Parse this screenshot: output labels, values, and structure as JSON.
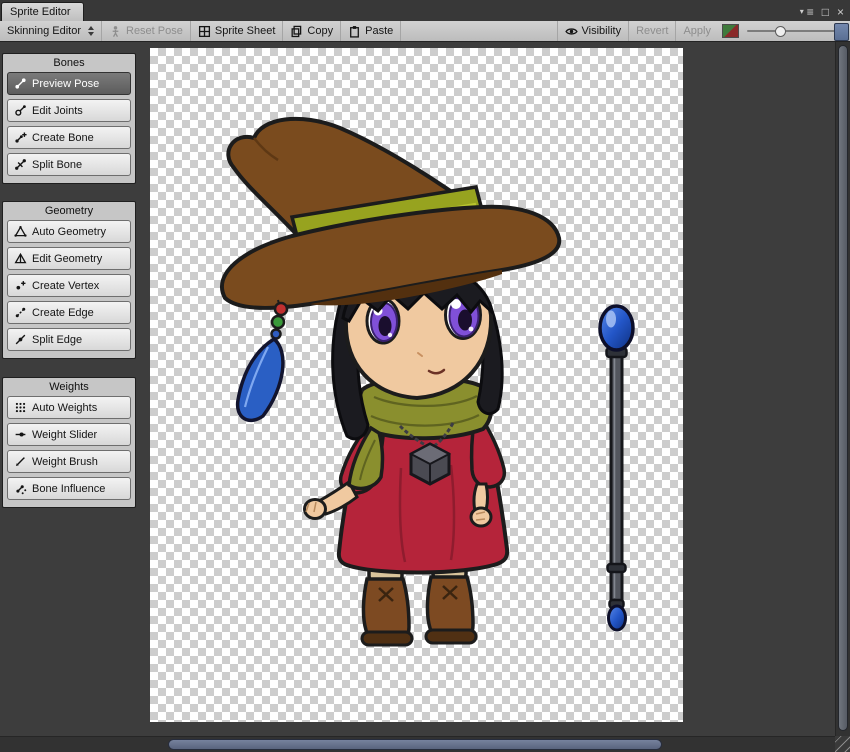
{
  "window": {
    "tab": "Sprite Editor",
    "icons": {
      "pane_arrow": "▾",
      "menu": "≡",
      "maximize": "□",
      "close": "×"
    }
  },
  "toolbar": {
    "mode": "Skinning Editor",
    "reset_pose": "Reset Pose",
    "sprite_sheet": "Sprite Sheet",
    "copy": "Copy",
    "paste": "Paste",
    "visibility": "Visibility",
    "revert": "Revert",
    "apply": "Apply"
  },
  "sidebar": {
    "panels": [
      {
        "title": "Bones",
        "items": [
          {
            "label": "Preview Pose",
            "active": true
          },
          {
            "label": "Edit Joints",
            "active": false
          },
          {
            "label": "Create Bone",
            "active": false
          },
          {
            "label": "Split Bone",
            "active": false
          }
        ]
      },
      {
        "title": "Geometry",
        "items": [
          {
            "label": "Auto Geometry",
            "active": false
          },
          {
            "label": "Edit Geometry",
            "active": false
          },
          {
            "label": "Create Vertex",
            "active": false
          },
          {
            "label": "Create Edge",
            "active": false
          },
          {
            "label": "Split Edge",
            "active": false
          }
        ]
      },
      {
        "title": "Weights",
        "items": [
          {
            "label": "Auto Weights",
            "active": false
          },
          {
            "label": "Weight Slider",
            "active": false
          },
          {
            "label": "Weight Brush",
            "active": false
          },
          {
            "label": "Bone Influence",
            "active": false
          }
        ]
      }
    ]
  },
  "canvas": {
    "sprite": "chibi witch character with staff on transparency checkerboard"
  },
  "colors": {
    "editor_bg": "#3d3d3d",
    "toolbar_bg": "#c2c2c2",
    "panel_bg": "#c6c6c6",
    "active_tool_bg": "#686868",
    "checker_light": "#ffffff",
    "checker_dark": "#cdcdcd",
    "dress_red": "#b5243a",
    "hat_brown": "#7a4b1e",
    "band_olive": "#97a31f",
    "scarf_olive": "#8a8f2e",
    "eye_purple": "#8050d8",
    "feather_blue": "#2a5fc4",
    "scroll_thumb": "#5d6880"
  }
}
